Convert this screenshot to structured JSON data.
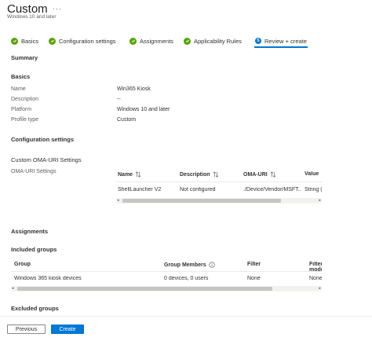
{
  "header": {
    "title": "Custom",
    "more_label": "···",
    "subtitle": "Windows 10 and later"
  },
  "steps": [
    {
      "label": "Basics",
      "state": "complete"
    },
    {
      "label": "Configuration settings",
      "state": "complete"
    },
    {
      "label": "Assignments",
      "state": "complete"
    },
    {
      "label": "Applicability Rules",
      "state": "complete"
    },
    {
      "label": "Review + create",
      "state": "current",
      "number": "5"
    }
  ],
  "summary": {
    "heading": "Summary",
    "basics": {
      "heading": "Basics",
      "fields": [
        {
          "label": "Name",
          "value": "Win365 Kiosk"
        },
        {
          "label": "Description",
          "value": "--"
        },
        {
          "label": "Platform",
          "value": "Windows 10 and later"
        },
        {
          "label": "Profile type",
          "value": "Custom"
        }
      ]
    },
    "configuration": {
      "heading": "Configuration settings",
      "custom_heading": "Custom OMA-URI Settings",
      "oma_label": "OMA-URI Settings",
      "columns": [
        "Name",
        "Description",
        "OMA-URI",
        "Value"
      ],
      "rows": [
        {
          "name": "ShellLauncher V2",
          "description": "Not configured",
          "oma_uri": "./Device/Vendor/MSFT...",
          "value": "String (XML file)"
        }
      ],
      "scroll_percent": 75
    },
    "assignments": {
      "heading": "Assignments",
      "included_heading": "Included groups",
      "columns": [
        "Group",
        "Group Members",
        "Filter",
        "Filter mode"
      ],
      "rows": [
        {
          "group": "Windows 365 kiosk devices",
          "members": "0 devices, 0 users",
          "filter": "None",
          "filter_mode": "None"
        }
      ],
      "excluded_heading": "Excluded groups",
      "scroll_percent": 80
    }
  },
  "footer": {
    "previous_label": "Previous",
    "create_label": "Create"
  },
  "colors": {
    "accent": "#0078d4",
    "success": "#57a300"
  },
  "icons": {
    "step_complete": "checkmark-circle-icon",
    "sort": "sort-arrows-icon",
    "info": "info-circle-icon"
  }
}
